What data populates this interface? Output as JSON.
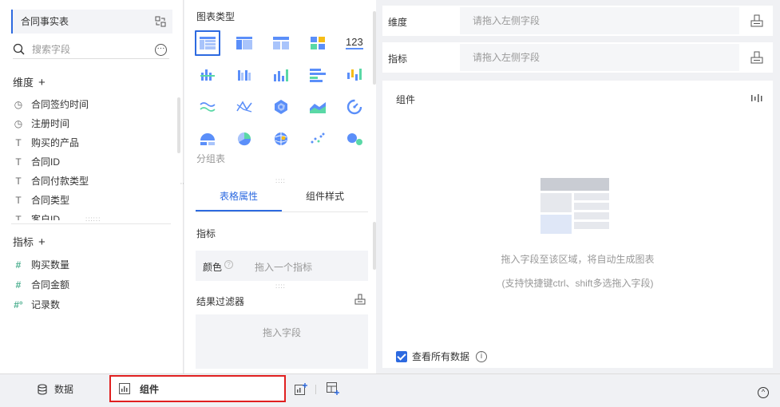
{
  "left": {
    "datasource": "合同事实表",
    "search_placeholder": "搜索字段",
    "dimension_title": "维度",
    "dimensions": [
      {
        "icon": "clock-icon",
        "glyph": "◷",
        "label": "合同签约时间"
      },
      {
        "icon": "clock-icon",
        "glyph": "◷",
        "label": "注册时间"
      },
      {
        "icon": "text-type-icon",
        "glyph": "T",
        "label": "购买的产品"
      },
      {
        "icon": "text-type-icon",
        "glyph": "T",
        "label": "合同ID"
      },
      {
        "icon": "text-type-icon",
        "glyph": "T",
        "label": "合同付款类型"
      },
      {
        "icon": "text-type-icon",
        "glyph": "T",
        "label": "合同类型"
      },
      {
        "icon": "text-type-icon",
        "glyph": "T",
        "label": "客户ID"
      }
    ],
    "metric_title": "指标",
    "metrics": [
      {
        "icon": "number-type-icon",
        "glyph": "#",
        "label": "购买数量"
      },
      {
        "icon": "number-type-icon",
        "glyph": "#",
        "label": "合同金额"
      },
      {
        "icon": "number-formula-icon",
        "glyph": "#°",
        "label": "记录数"
      }
    ]
  },
  "middle": {
    "chart_type_title": "图表类型",
    "group_label": "分组表",
    "tabs": [
      {
        "label": "表格属性",
        "active": true
      },
      {
        "label": "组件样式",
        "active": false
      }
    ],
    "metric_label": "指标",
    "color_label": "颜色",
    "color_placeholder": "拖入一个指标",
    "filter_label": "结果过滤器",
    "filter_placeholder": "拖入字段"
  },
  "right": {
    "dimension_label": "维度",
    "dimension_placeholder": "请拖入左侧字段",
    "metric_label": "指标",
    "metric_placeholder": "请拖入左侧字段",
    "canvas_title": "组件",
    "hint_line1": "拖入字段至该区域，将自动生成图表",
    "hint_line2": "(支持快捷键ctrl、shift多选拖入字段)",
    "view_all_label": "查看所有数据",
    "view_all_checked": true
  },
  "bottom": {
    "data_tab": "数据",
    "widget_tab": "组件"
  },
  "colors": {
    "accent": "#2d6ae0",
    "highlight_border": "#e02020",
    "chart_blue": "#5b8ff9",
    "chart_green": "#5ad8a6",
    "chart_gold": "#f6bd16"
  }
}
